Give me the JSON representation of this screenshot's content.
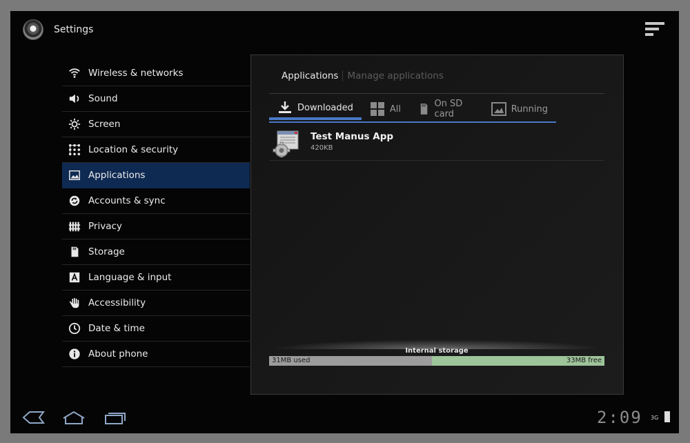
{
  "app_title": "Settings",
  "sidebar": {
    "items": [
      {
        "label": "Wireless & networks",
        "icon": "wifi-icon"
      },
      {
        "label": "Sound",
        "icon": "speaker-icon"
      },
      {
        "label": "Screen",
        "icon": "brightness-icon"
      },
      {
        "label": "Location & security",
        "icon": "location-grid-icon"
      },
      {
        "label": "Applications",
        "icon": "applications-icon",
        "active": true
      },
      {
        "label": "Accounts & sync",
        "icon": "sync-icon"
      },
      {
        "label": "Privacy",
        "icon": "privacy-fence-icon"
      },
      {
        "label": "Storage",
        "icon": "sd-card-icon"
      },
      {
        "label": "Language & input",
        "icon": "language-icon"
      },
      {
        "label": "Accessibility",
        "icon": "hand-icon"
      },
      {
        "label": "Date & time",
        "icon": "clock-icon"
      },
      {
        "label": "About phone",
        "icon": "info-icon"
      }
    ]
  },
  "panel": {
    "breadcrumb": {
      "current": "Applications",
      "sub": "Manage applications"
    },
    "tabs": [
      {
        "label": "Downloaded",
        "icon": "download-icon",
        "active": true
      },
      {
        "label": "All",
        "icon": "grid-icon"
      },
      {
        "label": "On SD card",
        "icon": "sd-card-icon"
      },
      {
        "label": "Running",
        "icon": "running-icon"
      }
    ],
    "apps": [
      {
        "name": "Test Manus App",
        "size": "420KB",
        "icon": "app-settings-icon"
      }
    ],
    "storage": {
      "label": "Internal storage",
      "used": "31MB used",
      "free": "33MB free",
      "used_fraction": 0.485
    }
  },
  "system_bar": {
    "time": "2:09",
    "network": "3G"
  },
  "colors": {
    "accent": "#4a79c6",
    "active_item_bg": "#0f2a52",
    "storage_used": "#9c9c9c",
    "storage_free": "#9ec49a"
  }
}
